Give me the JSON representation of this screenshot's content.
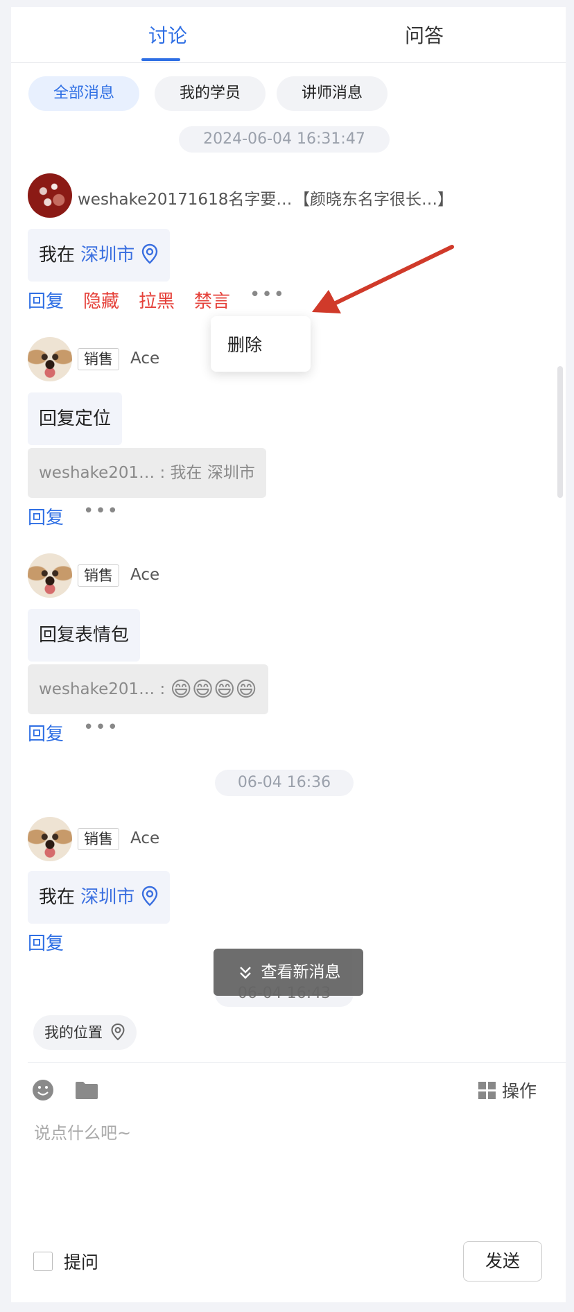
{
  "tabs": {
    "discussion": "讨论",
    "qa": "问答"
  },
  "filters": {
    "all": "全部消息",
    "my_students": "我的学员",
    "lecturer": "讲师消息"
  },
  "messages": [
    {
      "time": "2024-06-04 16:31:47",
      "user_name": "weshake20171618名字要…",
      "group_name": "【颜晓东名字很长…】",
      "text_prefix": "我在",
      "location": "深圳市",
      "actions": {
        "reply": "回复",
        "hide": "隐藏",
        "block": "拉黑",
        "mute": "禁言",
        "more": "•••"
      }
    },
    {
      "tag": "销售",
      "user_name": "Ace",
      "text": "回复定位",
      "quote": "weshake201… : 我在 深圳市",
      "actions": {
        "reply": "回复",
        "more": "•••"
      }
    },
    {
      "tag": "销售",
      "user_name": "Ace",
      "text": "回复表情包",
      "quote_prefix": "weshake201… :",
      "quote_emoji": "😄😄😄😄",
      "actions": {
        "reply": "回复",
        "more": "•••"
      }
    },
    {
      "time": "06-04 16:36",
      "tag": "销售",
      "user_name": "Ace",
      "text_prefix": "我在",
      "location": "深圳市",
      "actions": {
        "reply": "回复"
      }
    }
  ],
  "context_menu": {
    "delete": "删除"
  },
  "hidden_time": "06-04 16:43",
  "new_messages_toast": "查看新消息",
  "my_location": "我的位置",
  "toolbar": {
    "operate": "操作"
  },
  "composer": {
    "placeholder": "说点什么吧~",
    "ask_label": "提问",
    "send": "发送"
  },
  "colors": {
    "accent": "#2f6fe4",
    "danger": "#e5413a",
    "arrow": "#d03a2a"
  },
  "icons": [
    "location-pin-icon",
    "smiley-icon",
    "folder-icon",
    "grid-icon",
    "chevron-double-down-icon",
    "arrow-annotation"
  ]
}
